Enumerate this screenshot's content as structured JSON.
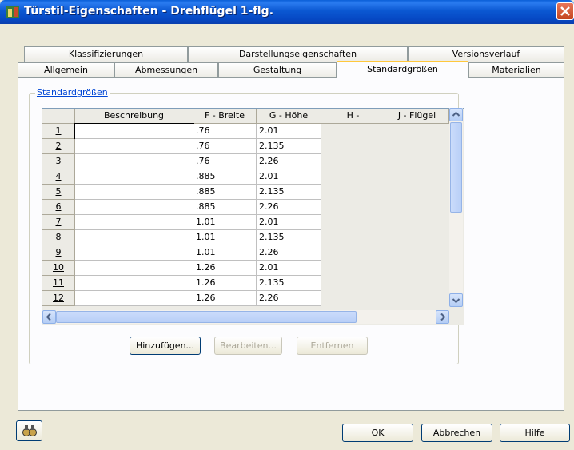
{
  "window": {
    "title": "Türstil-Eigenschaften - Drehflügel 1-flg."
  },
  "tabs_back": [
    "Klassifizierungen",
    "Darstellungseigenschaften",
    "Versionsverlauf"
  ],
  "tabs_front": [
    "Allgemein",
    "Abmessungen",
    "Gestaltung",
    "Standardgrößen",
    "Materialien"
  ],
  "active_tab": "Standardgrößen",
  "group": {
    "label": "Standardgrößen"
  },
  "grid": {
    "columns": [
      "Beschreibung",
      "F - Breite",
      "G - Höhe",
      "H -",
      "J - Flügel"
    ],
    "rows": [
      {
        "num": "1",
        "desc": "",
        "width": ".76",
        "height": "2.01"
      },
      {
        "num": "2",
        "desc": "",
        "width": ".76",
        "height": "2.135"
      },
      {
        "num": "3",
        "desc": "",
        "width": ".76",
        "height": "2.26"
      },
      {
        "num": "4",
        "desc": "",
        "width": ".885",
        "height": "2.01"
      },
      {
        "num": "5",
        "desc": "",
        "width": ".885",
        "height": "2.135"
      },
      {
        "num": "6",
        "desc": "",
        "width": ".885",
        "height": "2.26"
      },
      {
        "num": "7",
        "desc": "",
        "width": "1.01",
        "height": "2.01"
      },
      {
        "num": "8",
        "desc": "",
        "width": "1.01",
        "height": "2.135"
      },
      {
        "num": "9",
        "desc": "",
        "width": "1.01",
        "height": "2.26"
      },
      {
        "num": "10",
        "desc": "",
        "width": "1.26",
        "height": "2.01"
      },
      {
        "num": "11",
        "desc": "",
        "width": "1.26",
        "height": "2.135"
      },
      {
        "num": "12",
        "desc": "",
        "width": "1.26",
        "height": "2.26"
      }
    ]
  },
  "buttons": {
    "add": "Hinzufügen...",
    "edit": "Bearbeiten...",
    "remove": "Entfernen",
    "ok": "OK",
    "cancel": "Abbrechen",
    "help": "Hilfe"
  },
  "colors": {
    "titlebar": "#0a5fd8",
    "active_tab_accent": "#ffc83c",
    "group_label": "#0046d5"
  }
}
